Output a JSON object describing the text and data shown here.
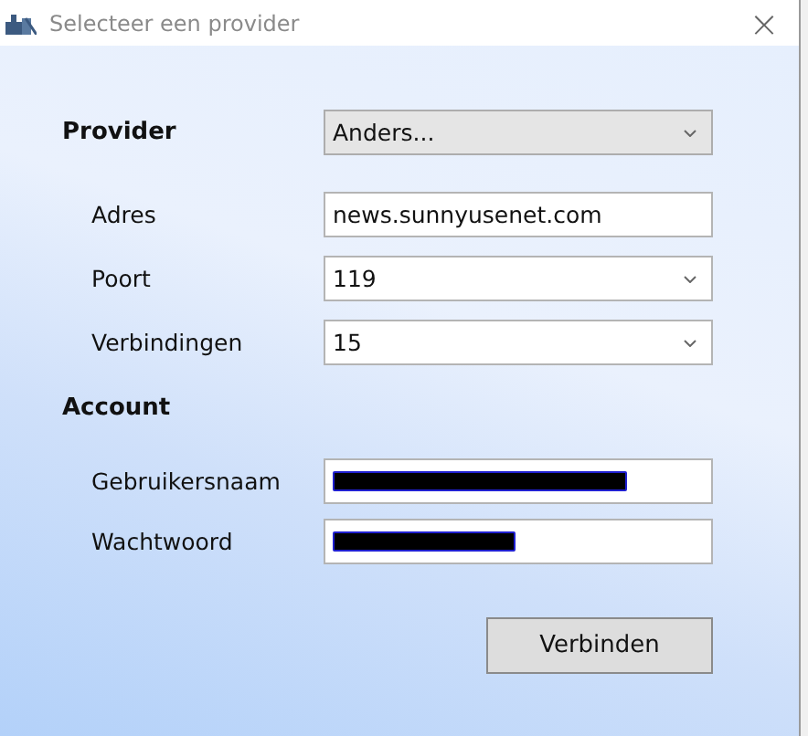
{
  "window": {
    "title": "Selecteer een provider",
    "close": "×"
  },
  "provider": {
    "label": "Provider",
    "value": "Anders...",
    "kind": "dropdown"
  },
  "server_fields": [
    {
      "label": "Adres",
      "value": "news.sunnyusenet.com",
      "kind": "text"
    },
    {
      "label": "Poort",
      "value": "119",
      "kind": "dropdown"
    },
    {
      "label": "Verbindingen",
      "value": "15",
      "kind": "dropdown"
    }
  ],
  "account": {
    "heading": "Account",
    "fields": [
      {
        "label": "Gebruikersnaam",
        "kind": "text",
        "redacted": true
      },
      {
        "label": "Wachtwoord",
        "kind": "text",
        "redacted": true
      }
    ]
  },
  "buttons": [
    "Verbinden"
  ]
}
